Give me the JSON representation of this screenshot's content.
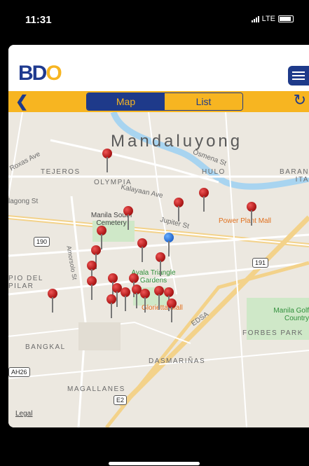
{
  "status": {
    "time": "11:31",
    "network": "LTE"
  },
  "header": {
    "logo_main": "BD",
    "logo_accent": "O"
  },
  "toolbar": {
    "tabs": [
      {
        "label": "Map"
      },
      {
        "label": "List"
      }
    ]
  },
  "map": {
    "labels": {
      "mandaluyong": "Mandaluyong",
      "tejeros": "TEJEROS",
      "olympia": "OLYMPIA",
      "hulo": "HULO",
      "barangka": "BARAN ITA",
      "roxas": "Roxas Ave",
      "osmena": "Osmena St",
      "kalayaan": "Kalayaan Ave",
      "jupiter": "Jupiter St",
      "cemetery": "Manila South Cemetery",
      "power_plant": "Power Plant Mall",
      "ayala": "Ayala Triangle Gardens",
      "glorietta": "Glorietta Mall",
      "pio_del_pilar": "PIO DEL PILAR",
      "amorsolo": "Amorsolo St",
      "manila_golf": "Manila Golf Country",
      "forbes": "FORBES PARK",
      "bangkal": "BANGKAL",
      "dasmarinas": "DASMARIÑAS",
      "magallanes": "MAGALLANES",
      "legal": "Legal",
      "edsa": "EDSA",
      "tagong": "lagong St"
    },
    "shields": {
      "r190": "190",
      "r191": "191",
      "ah26": "AH26",
      "e2": "E2"
    }
  }
}
